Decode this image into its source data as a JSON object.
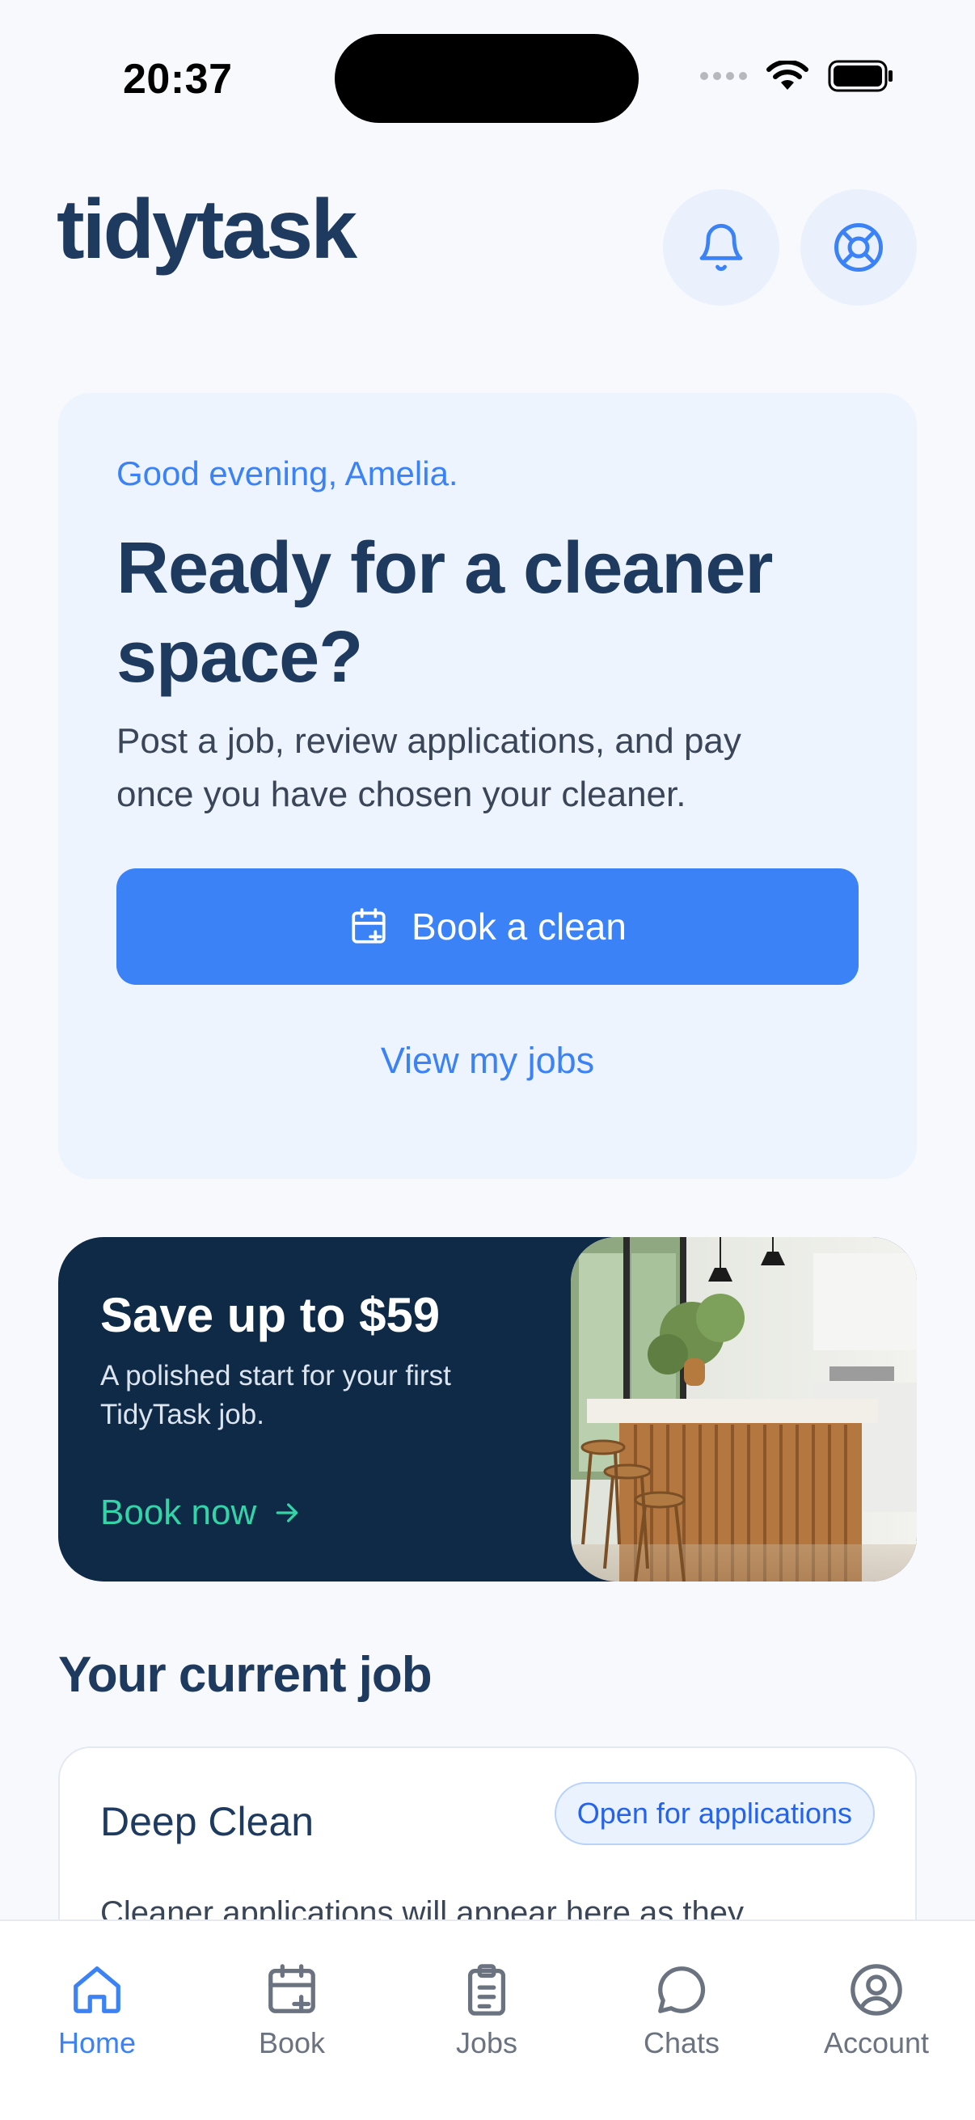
{
  "status": {
    "time": "20:37"
  },
  "header": {
    "logo": "tidytask"
  },
  "hero": {
    "greeting": "Good evening, Amelia.",
    "title": "Ready for a cleaner space?",
    "subtitle": "Post a job, review applications, and pay once you have chosen your cleaner.",
    "book_button": "Book a clean",
    "view_jobs": "View my jobs"
  },
  "promo": {
    "title": "Save up to $59",
    "subtitle": "A polished start for your first TidyTask job.",
    "cta": "Book now"
  },
  "current_job": {
    "section_title": "Your current job",
    "job_title": "Deep Clean",
    "status_badge": "Open for applications",
    "description": "Cleaner applications will appear here as they"
  },
  "tabbar": {
    "items": [
      {
        "label": "Home",
        "icon": "home-icon",
        "active": true
      },
      {
        "label": "Book",
        "icon": "calendar-plus-icon",
        "active": false
      },
      {
        "label": "Jobs",
        "icon": "clipboard-icon",
        "active": false
      },
      {
        "label": "Chats",
        "icon": "chat-icon",
        "active": false
      },
      {
        "label": "Account",
        "icon": "account-icon",
        "active": false
      }
    ]
  },
  "colors": {
    "accent": "#3b82f6",
    "navy": "#1e3a5f",
    "promo_bg": "#0f2a46",
    "promo_link": "#34d3a8"
  }
}
